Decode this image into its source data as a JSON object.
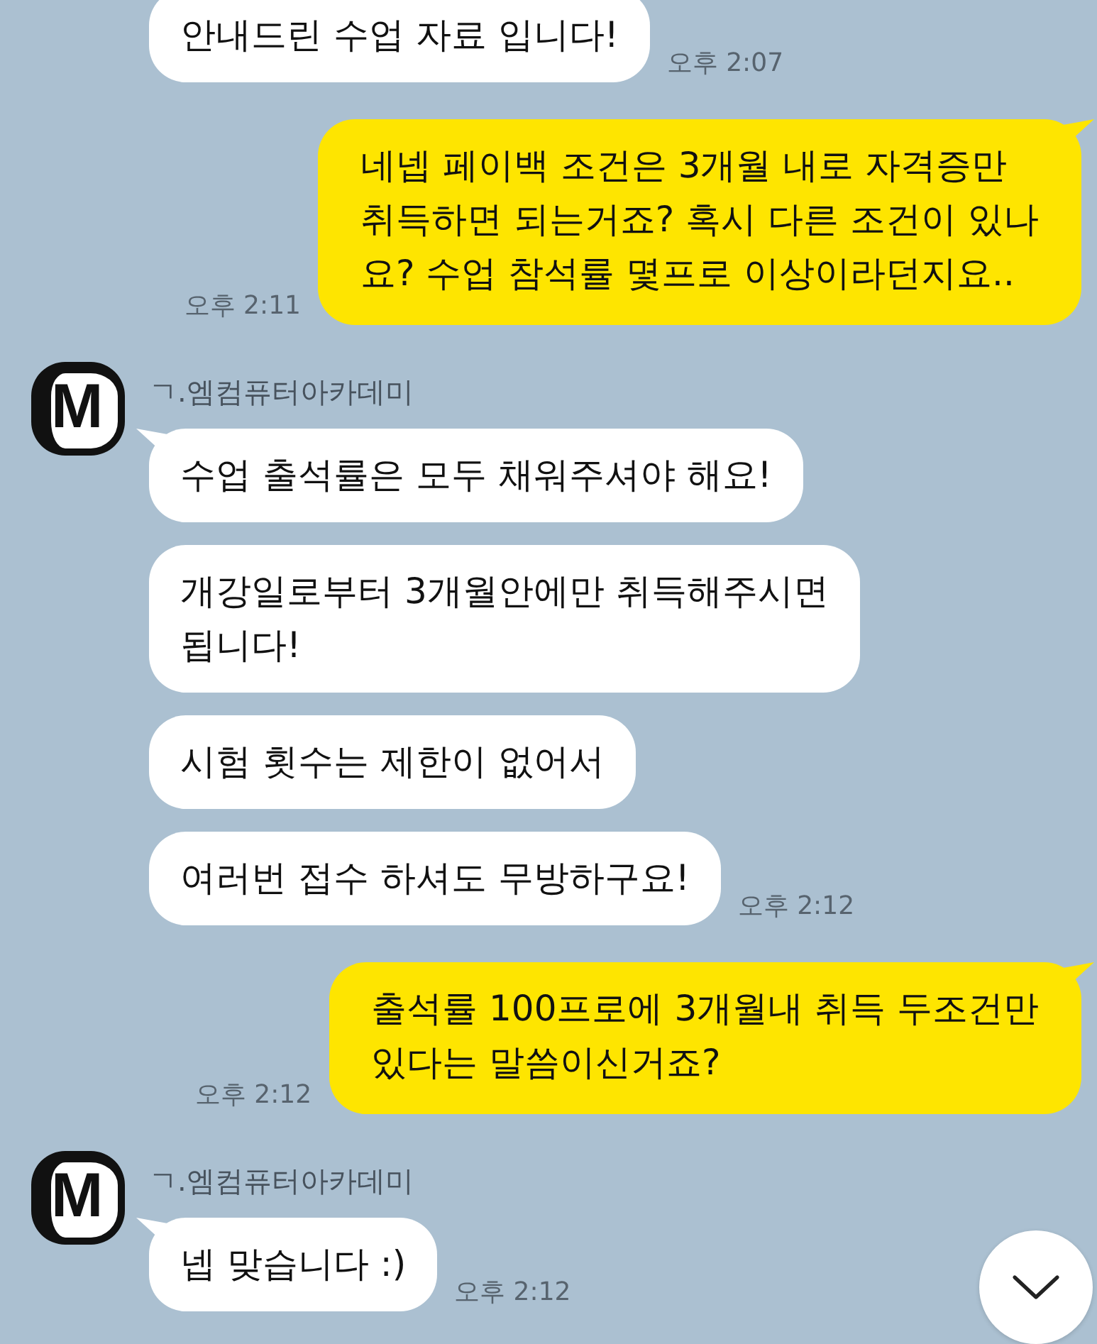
{
  "messages": [
    {
      "kind": "received",
      "bubbles": [
        "안내드린 수업 자료 입니다!"
      ],
      "time": "오후 2:07"
    },
    {
      "kind": "sent",
      "bubbles": [
        "네넵 페이백 조건은 3개월 내로 자격증만\n취득하면 되는거죠? 혹시 다른 조건이 있나\n요? 수업 참석률 몇프로 이상이라던지요.."
      ],
      "time": "오후 2:11"
    },
    {
      "kind": "received",
      "sender": "ㄱ.엠컴퓨터아카데미",
      "avatar_letter": "M",
      "bubbles": [
        "수업 출석률은 모두 채워주셔야 해요!",
        "개강일로부터 3개월안에만 취득해주시면\n됩니다!",
        "시험 횟수는 제한이 없어서",
        "여러번 접수 하셔도 무방하구요!"
      ],
      "time": "오후 2:12"
    },
    {
      "kind": "sent",
      "bubbles": [
        "출석률 100프로에 3개월내 취득 두조건만\n있다는 말씀이신거죠?"
      ],
      "time": "오후 2:12"
    },
    {
      "kind": "received",
      "sender": "ㄱ.엠컴퓨터아카데미",
      "avatar_letter": "M",
      "bubbles": [
        "넵 맞습니다 :)"
      ],
      "time": "오후 2:12"
    }
  ]
}
